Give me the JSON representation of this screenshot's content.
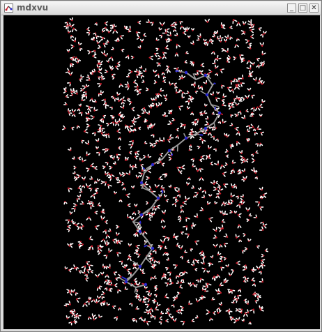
{
  "window": {
    "title": "mdxvu",
    "icons": {
      "app": "molecule-icon",
      "minimize": "minimize-icon",
      "maximize": "maximize-icon",
      "close": "close-icon"
    },
    "buttons": {
      "minimize_glyph": "_",
      "maximize_glyph": "□",
      "close_glyph": "✕"
    }
  },
  "viewport": {
    "background_color": "#000000",
    "content": "molecular-dynamics-water-box-with-peptide",
    "colors": {
      "oxygen": "#c81e2c",
      "hydrogen": "#ffffff",
      "carbon": "#9a9a9a",
      "nitrogen": "#2a2ad0"
    }
  }
}
